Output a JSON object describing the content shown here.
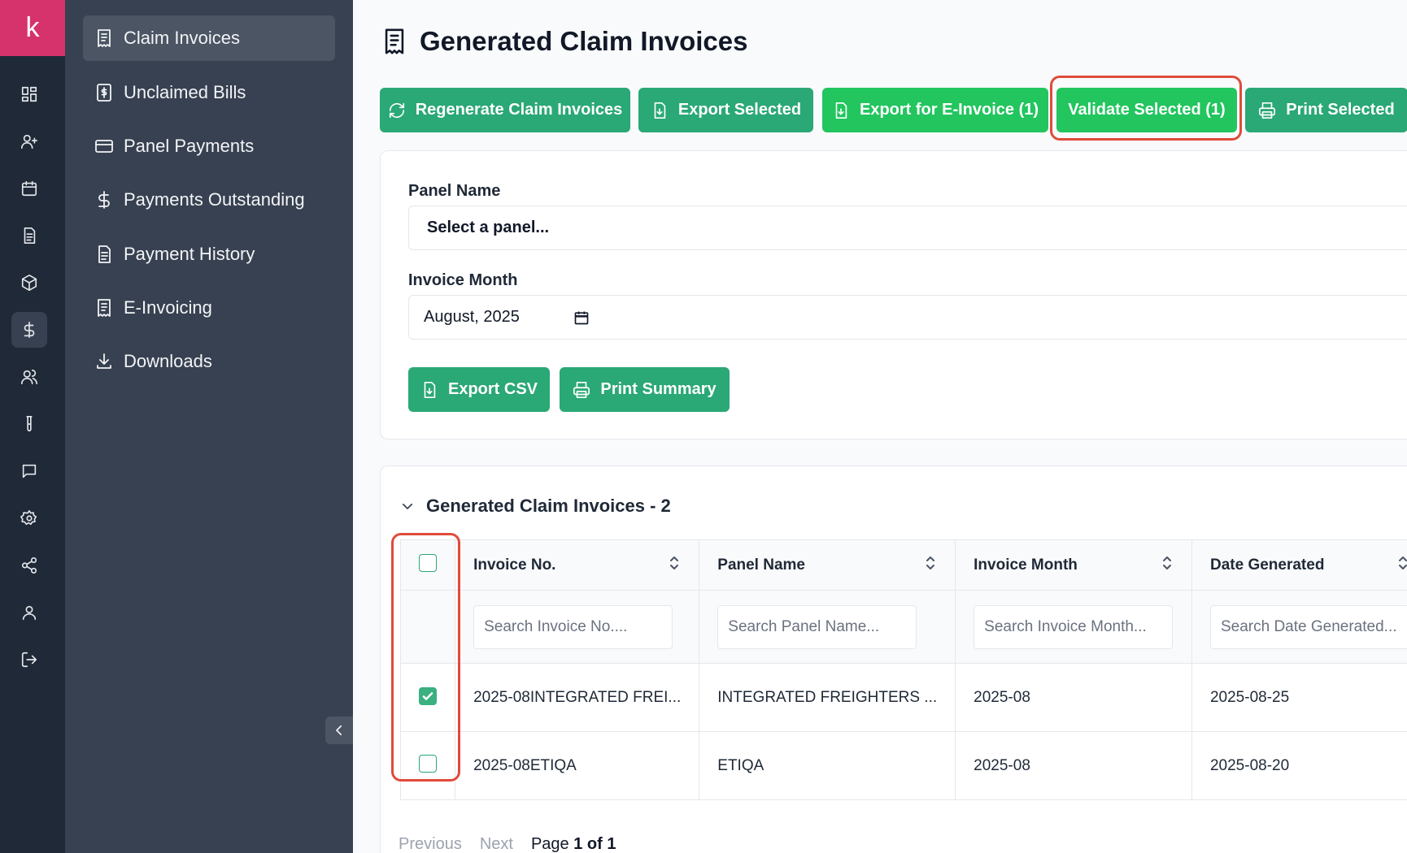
{
  "rail": {
    "logo": "k"
  },
  "sidebar": {
    "items": [
      {
        "label": "Claim Invoices"
      },
      {
        "label": "Unclaimed Bills"
      },
      {
        "label": "Panel Payments"
      },
      {
        "label": "Payments Outstanding"
      },
      {
        "label": "Payment History"
      },
      {
        "label": "E-Invoicing"
      },
      {
        "label": "Downloads"
      }
    ]
  },
  "header": {
    "title": "Generated Claim Invoices"
  },
  "toolbar": {
    "regenerate": "Regenerate Claim Invoices",
    "export_selected": "Export Selected",
    "export_einvoice": "Export for E-Invoice (1)",
    "validate_selected": "Validate Selected (1)",
    "print_selected": "Print Selected"
  },
  "filters": {
    "panel_label": "Panel Name",
    "panel_value": "Select a panel...",
    "month_label": "Invoice Month",
    "month_value": "August, 2025",
    "export_csv": "Export CSV",
    "print_summary": "Print Summary"
  },
  "table": {
    "section_title": "Generated Claim Invoices - 2",
    "columns": [
      "Invoice No.",
      "Panel Name",
      "Invoice Month",
      "Date Generated"
    ],
    "placeholders": [
      "Search Invoice No....",
      "Search Panel Name...",
      "Search Invoice Month...",
      "Search Date Generated..."
    ],
    "rows": [
      {
        "checked": true,
        "cells": [
          "2025-08INTEGRATED FREI...",
          "INTEGRATED FREIGHTERS ...",
          "2025-08",
          "2025-08-25"
        ]
      },
      {
        "checked": false,
        "cells": [
          "2025-08ETIQA",
          "ETIQA",
          "2025-08",
          "2025-08-20"
        ]
      }
    ]
  },
  "pagination": {
    "previous": "Previous",
    "next": "Next",
    "page_prefix": "Page",
    "page_info": "1 of 1"
  },
  "colors": {
    "primary": "#2aa876",
    "accent_bright": "#22c55e",
    "logo": "#d6336c",
    "highlight": "#e04b3a"
  }
}
